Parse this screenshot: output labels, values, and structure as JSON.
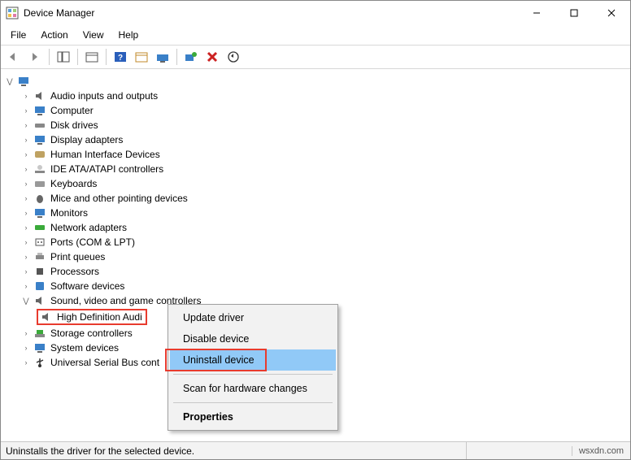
{
  "window": {
    "title": "Device Manager"
  },
  "menubar": {
    "file": "File",
    "action": "Action",
    "view": "View",
    "help": "Help"
  },
  "tree": {
    "root": "",
    "items": [
      "Audio inputs and outputs",
      "Computer",
      "Disk drives",
      "Display adapters",
      "Human Interface Devices",
      "IDE ATA/ATAPI controllers",
      "Keyboards",
      "Mice and other pointing devices",
      "Monitors",
      "Network adapters",
      "Ports (COM & LPT)",
      "Print queues",
      "Processors",
      "Software devices",
      "Sound, video and game controllers",
      "Storage controllers",
      "System devices",
      "Universal Serial Bus cont"
    ],
    "selected_child": "High Definition Audi"
  },
  "context_menu": {
    "update": "Update driver",
    "disable": "Disable device",
    "uninstall": "Uninstall device",
    "scan": "Scan for hardware changes",
    "properties": "Properties"
  },
  "statusbar": {
    "text": "Uninstalls the driver for the selected device.",
    "watermark": "wsxdn.com"
  }
}
